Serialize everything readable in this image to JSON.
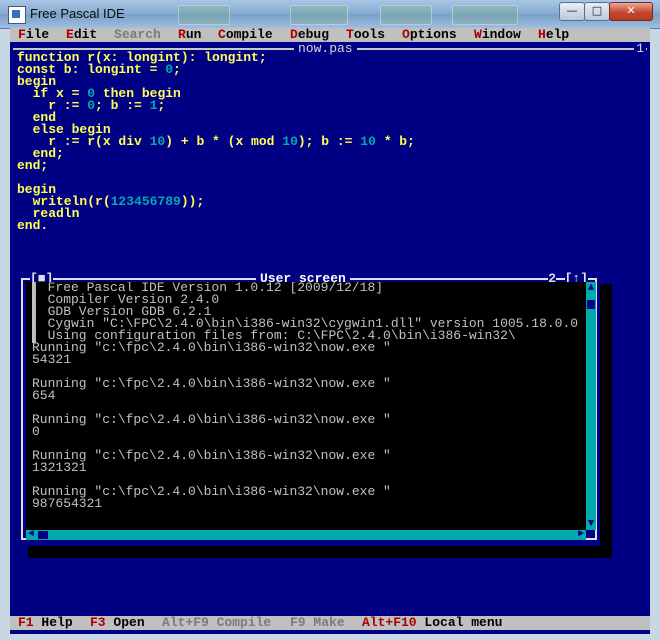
{
  "window": {
    "title": "Free Pascal IDE",
    "buttons": {
      "minimize": "—",
      "maximize": "□",
      "close": "✕"
    }
  },
  "menu": [
    {
      "hot": "F",
      "rest": "ile"
    },
    {
      "hot": "E",
      "rest": "dit"
    },
    {
      "hot": "S",
      "rest": "earch",
      "disabled": true
    },
    {
      "hot": "R",
      "rest": "un"
    },
    {
      "hot": "C",
      "rest": "ompile"
    },
    {
      "hot": "D",
      "rest": "ebug"
    },
    {
      "hot": "T",
      "rest": "ools"
    },
    {
      "hot": "O",
      "rest": "ptions"
    },
    {
      "hot": "W",
      "rest": "indow"
    },
    {
      "hot": "H",
      "rest": "elp"
    }
  ],
  "editor": {
    "filename": "now.pas",
    "window_number": "1"
  },
  "user_screen": {
    "title": "User screen",
    "close_glyph": "[■]",
    "number": "2",
    "zoom_glyph": "[↑]",
    "output": [
      "▌ Free Pascal IDE Version 1.0.12 [2009/12/18]",
      "▌ Compiler Version 2.4.0",
      "▌ GDB Version GDB 6.2.1",
      "▌ Cygwin \"C:\\FPC\\2.4.0\\bin\\i386-win32\\cygwin1.dll\" version 1005.18.0.0",
      "▌ Using configuration files from: C:\\FPC\\2.4.0\\bin\\i386-win32\\",
      "Running \"c:\\fpc\\2.4.0\\bin\\i386-win32\\now.exe \"",
      "54321",
      "",
      "Running \"c:\\fpc\\2.4.0\\bin\\i386-win32\\now.exe \"",
      "654",
      "",
      "Running \"c:\\fpc\\2.4.0\\bin\\i386-win32\\now.exe \"",
      "0",
      "",
      "Running \"c:\\fpc\\2.4.0\\bin\\i386-win32\\now.exe \"",
      "1321321",
      "",
      "Running \"c:\\fpc\\2.4.0\\bin\\i386-win32\\now.exe \"",
      "987654321"
    ]
  },
  "status": [
    {
      "key": "F1",
      "label": " Help"
    },
    {
      "key": "F3",
      "label": " Open"
    },
    {
      "key": "Alt+F9",
      "label": " Compile",
      "disabled": true
    },
    {
      "key": "F9",
      "label": " Make",
      "disabled": true
    },
    {
      "key": "Alt+F10",
      "label": " Local menu"
    }
  ],
  "colors": {
    "ide_background": "#000084",
    "code_text": "#ffff55",
    "numbers": "#00aaaa",
    "hotkey": "#aa0000"
  }
}
